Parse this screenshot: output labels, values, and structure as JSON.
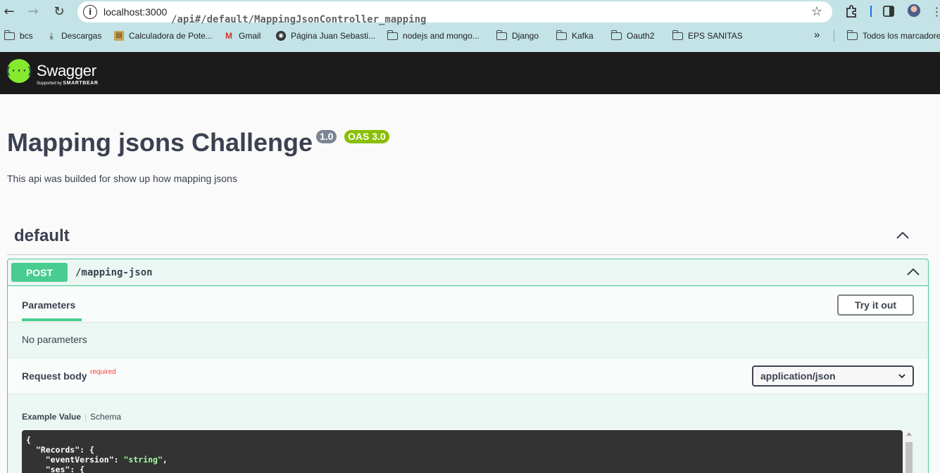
{
  "browser": {
    "url_host": "localhost:3000",
    "url_path": "/api#/default/MappingJsonController_mapping",
    "bookmarks": [
      {
        "label": "bcs",
        "icon": "folder-icon"
      },
      {
        "label": "Descargas",
        "icon": "download-icon"
      },
      {
        "label": "Calculadora de Pote...",
        "icon": "calculator-icon"
      },
      {
        "label": "Gmail",
        "icon": "gmail-icon"
      },
      {
        "label": "Página Juan Sebasti...",
        "icon": "globe-icon"
      },
      {
        "label": "nodejs and mongo...",
        "icon": "folder-icon"
      },
      {
        "label": "Django",
        "icon": "folder-icon"
      },
      {
        "label": "Kafka",
        "icon": "folder-icon"
      },
      {
        "label": "Oauth2",
        "icon": "folder-icon"
      },
      {
        "label": "EPS SANITAS",
        "icon": "folder-icon"
      }
    ],
    "more_bookmarks": "»",
    "all_bookmarks": "Todos los marcadores"
  },
  "topbar": {
    "logo_glyph": "{···}",
    "name": "Swagger",
    "supported_by": "Supported by",
    "smartbear": "SMARTBEAR"
  },
  "info": {
    "title": "Mapping jsons Challenge",
    "version": "1.0",
    "oas": "OAS 3.0",
    "description": "This api was builded for show up how mapping jsons"
  },
  "tag": {
    "name": "default"
  },
  "operation": {
    "method": "POST",
    "path": "/mapping-json",
    "parameters_tab": "Parameters",
    "try_button": "Try it out",
    "no_parameters": "No parameters",
    "request_body_label": "Request body",
    "required_label": "required",
    "content_type": "application/json",
    "example_value_tab": "Example Value",
    "schema_tab": "Schema",
    "code_lines": [
      {
        "text": "{",
        "str": ""
      },
      {
        "text": "  \"Records\": {",
        "str": ""
      },
      {
        "text": "    \"eventVersion\": ",
        "str": "\"string\"",
        "tail": ","
      },
      {
        "text": "    \"ses\": {",
        "str": ""
      }
    ]
  },
  "colors": {
    "post_accent": "#49cc90",
    "topbar_bg": "#1b1b1b",
    "swagger_green": "#85ea2d",
    "oas_badge": "#89bf04",
    "version_badge": "#7d8492",
    "required_red": "#f93e3e"
  }
}
